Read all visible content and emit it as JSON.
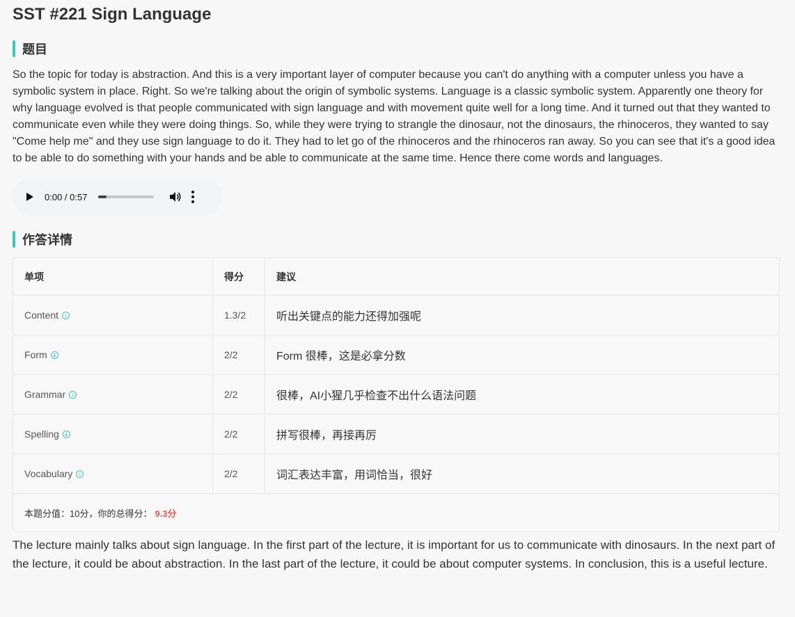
{
  "page": {
    "title": "SST #221 Sign Language"
  },
  "question": {
    "section_title": "题目",
    "text": "So the topic for today is abstraction. And this is a very important layer of computer because you can't do anything with a computer unless you have a symbolic system in place. Right. So we're talking about the origin of symbolic systems. Language is a classic symbolic system. Apparently one theory for why language evolved is that people communicated with sign language and with movement quite well for a long time. And it turned out that they wanted to communicate even while they were doing things. So, while they were trying to strangle the dinosaur, not the dinosaurs, the rhinoceros, they wanted to say \"Come help me\" and they use sign language to do it. They had to let go of the rhinoceros and the rhinoceros ran away. So you can see that it's a good idea to be able to do something with your hands and be able to communicate at the same time. Hence there come words and languages."
  },
  "audio": {
    "time": "0:00 / 0:57",
    "progress": 0.14,
    "icons": [
      "play-icon",
      "volume-icon",
      "more-options-icon"
    ]
  },
  "details": {
    "section_title": "作答详情",
    "headers": {
      "item": "单项",
      "score": "得分",
      "advice": "建议"
    },
    "rows": [
      {
        "item": "Content",
        "score": "1.3/2",
        "advice": "听出关键点的能力还得加强呢"
      },
      {
        "item": "Form",
        "score": "2/2",
        "advice": "Form 很棒，这是必拿分数"
      },
      {
        "item": "Grammar",
        "score": "2/2",
        "advice": "很棒，AI小猩几乎检查不出什么语法问题"
      },
      {
        "item": "Spelling",
        "score": "2/2",
        "advice": "拼写很棒，再接再厉"
      },
      {
        "item": "Vocabulary",
        "score": "2/2",
        "advice": "词汇表达丰富，用词恰当，很好"
      }
    ],
    "total_label": "本题分值：10分，你的总得分：",
    "total_score": "9.3分"
  },
  "answer": {
    "text": "The lecture mainly talks about sign language. In the first part of the lecture, it is important for us to communicate with dinosaurs. In the next part of the lecture, it could be about abstraction. In the last part of the lecture, it could be about computer systems. In conclusion, this is a useful lecture."
  },
  "colors": {
    "accent": "#3ec6b8",
    "score": "#ee5a4f",
    "background": "#f7f7f7"
  }
}
